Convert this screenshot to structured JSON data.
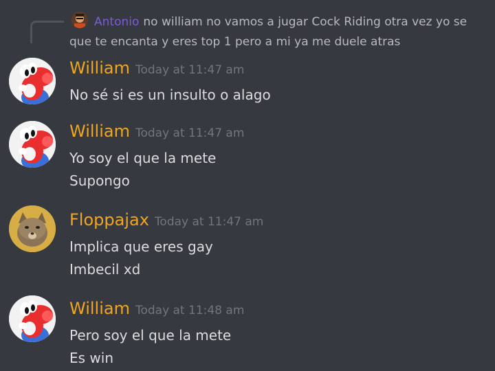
{
  "reply": {
    "author": "Antonio",
    "text": "no william no vamos a jugar Cock Riding otra vez yo se que te encanta y eres top 1 pero a mi ya me duele atras"
  },
  "messages": [
    {
      "author": "William",
      "author_color": "#f0a61e",
      "avatar": "yoshi-avatar",
      "timestamp": "Today at 11:47 am",
      "lines": [
        "No sé si es un insulto o alago"
      ]
    },
    {
      "author": "William",
      "author_color": "#f0a61e",
      "avatar": "yoshi-avatar",
      "timestamp": "Today at 11:47 am",
      "lines": [
        "Yo soy el que la mete",
        "Supongo"
      ]
    },
    {
      "author": "Floppajax",
      "author_color": "#f0a61e",
      "avatar": "cat-avatar",
      "timestamp": "Today at 11:47 am",
      "lines": [
        "Implica que eres gay",
        "Imbecil xd"
      ]
    },
    {
      "author": "William",
      "author_color": "#f0a61e",
      "avatar": "yoshi-avatar",
      "timestamp": "Today at 11:48 am",
      "lines": [
        "Pero soy el que la mete",
        "Es win"
      ]
    }
  ]
}
